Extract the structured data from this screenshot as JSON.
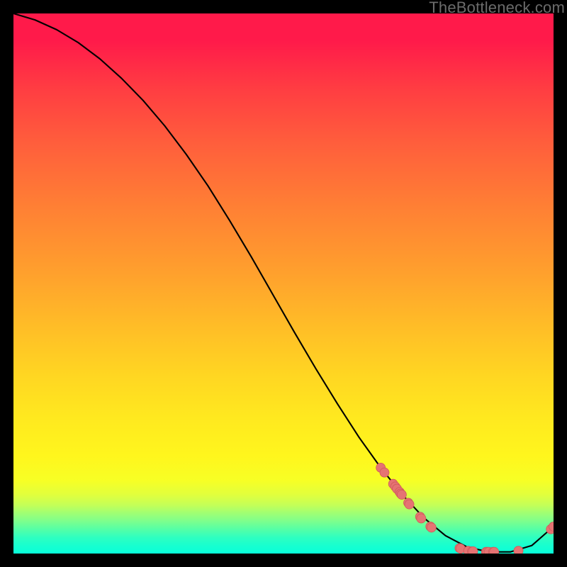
{
  "watermark": "TheBottleneck.com",
  "colors": {
    "dot_fill": "#e57373",
    "dot_stroke": "#d05a5a",
    "line": "#000000",
    "frame_bg_top": "#ff1a4a",
    "frame_bg_bottom": "#08ffd9"
  },
  "chart_data": {
    "type": "line",
    "title": "",
    "xlabel": "",
    "ylabel": "",
    "xlim": [
      0,
      100
    ],
    "ylim": [
      0,
      100
    ],
    "series": [
      {
        "name": "curve",
        "x": [
          0,
          4,
          8,
          12,
          16,
          20,
          24,
          28,
          32,
          36,
          40,
          44,
          48,
          52,
          56,
          60,
          64,
          68,
          72,
          76,
          80,
          84,
          88,
          92,
          96,
          100
        ],
        "y": [
          100,
          98.8,
          97.0,
          94.6,
          91.6,
          88.0,
          83.9,
          79.2,
          73.9,
          68.1,
          61.7,
          55.0,
          48.0,
          41.0,
          34.2,
          27.7,
          21.5,
          15.9,
          10.9,
          6.6,
          3.3,
          1.2,
          0.3,
          0.3,
          1.5,
          5.0
        ]
      },
      {
        "name": "markers",
        "x": [
          68.0,
          68.7,
          70.3,
          70.7,
          71.0,
          71.5,
          71.7,
          71.9,
          73.1,
          73.3,
          75.3,
          75.5,
          77.2,
          77.4,
          82.6,
          82.8,
          84.2,
          84.9,
          85.1,
          87.5,
          87.7,
          88.0,
          88.8,
          89.0,
          93.5,
          99.5,
          100.0
        ],
        "y": [
          15.9,
          15.0,
          12.9,
          12.4,
          12.0,
          11.4,
          11.1,
          10.9,
          9.4,
          9.1,
          6.8,
          6.5,
          5.0,
          4.8,
          1.0,
          0.9,
          0.5,
          0.4,
          0.4,
          0.3,
          0.3,
          0.3,
          0.3,
          0.3,
          0.5,
          4.5,
          5.0
        ]
      }
    ]
  }
}
